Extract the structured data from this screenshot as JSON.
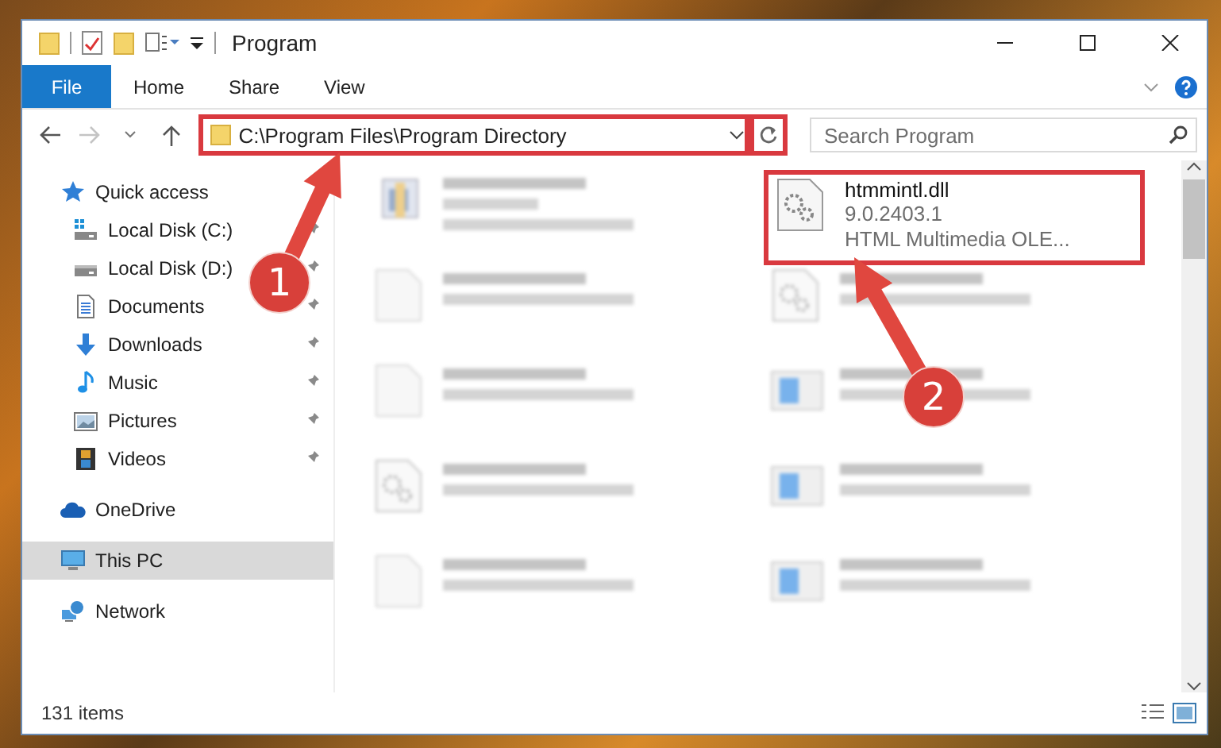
{
  "window": {
    "title": "Program"
  },
  "ribbon_tabs": [
    {
      "label": "File",
      "kind": "backstage"
    },
    {
      "label": "Home",
      "kind": "tab"
    },
    {
      "label": "Share",
      "kind": "tab"
    },
    {
      "label": "View",
      "kind": "tab"
    }
  ],
  "address_bar": {
    "path": "C:\\Program Files\\Program Directory",
    "highlighted": true
  },
  "search": {
    "placeholder": "Search Program"
  },
  "navigation": [
    {
      "label": "Quick access",
      "kind": "star",
      "selected": false,
      "children": [
        {
          "label": "Local Disk (C:)",
          "kind": "systemdrive",
          "pinned": true,
          "selected": false
        },
        {
          "label": "Local Disk (D:)",
          "kind": "drive",
          "pinned": true,
          "selected": false
        },
        {
          "label": "Documents",
          "kind": "documents",
          "pinned": true,
          "selected": false
        },
        {
          "label": "Downloads",
          "kind": "downloads",
          "pinned": true,
          "selected": false
        },
        {
          "label": "Music",
          "kind": "music",
          "pinned": true,
          "selected": false
        },
        {
          "label": "Pictures",
          "kind": "pictures",
          "pinned": true,
          "selected": false
        },
        {
          "label": "Videos",
          "kind": "videos",
          "pinned": true,
          "selected": false
        }
      ]
    },
    {
      "label": "OneDrive",
      "kind": "cloud",
      "selected": false
    },
    {
      "label": "This PC",
      "kind": "computer",
      "selected": true
    },
    {
      "label": "Network",
      "kind": "network",
      "selected": false
    }
  ],
  "files": [
    {
      "kind": "installer",
      "blurred": true,
      "highlighted": false
    },
    {
      "name": "htmmintl.dll",
      "details": [
        "9.0.2403.1",
        "HTML Multimedia OLE..."
      ],
      "kind": "library",
      "blurred": false,
      "highlighted": true
    },
    {
      "kind": "blank",
      "blurred": true,
      "highlighted": false
    },
    {
      "kind": "library",
      "blurred": true,
      "highlighted": false
    },
    {
      "kind": "blank",
      "blurred": true,
      "highlighted": false
    },
    {
      "kind": "app",
      "blurred": true,
      "highlighted": false
    },
    {
      "kind": "library",
      "blurred": true,
      "highlighted": false
    },
    {
      "kind": "app",
      "blurred": true,
      "highlighted": false
    },
    {
      "kind": "blank",
      "blurred": true,
      "highlighted": false
    },
    {
      "kind": "app",
      "blurred": true,
      "highlighted": false
    }
  ],
  "status_bar": {
    "item_count": "131 items"
  },
  "callouts": [
    {
      "number": "1"
    },
    {
      "number": "2"
    }
  ]
}
